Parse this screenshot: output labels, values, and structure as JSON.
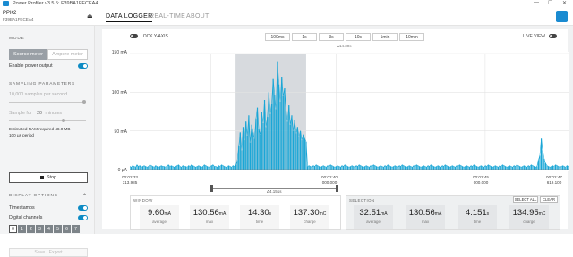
{
  "titlebar": {
    "title": "Power Profiler v3.5.5: F39BA1FECEA4",
    "minimize": "—",
    "maximize": "☐",
    "close": "✕"
  },
  "device": {
    "name": "PPK2",
    "serial": "F39BA1FECEA4"
  },
  "nav": {
    "tabs": [
      {
        "label": "DATA LOGGER"
      },
      {
        "label": "REAL-TIME"
      },
      {
        "label": "ABOUT"
      }
    ]
  },
  "sidebar": {
    "mode_title": "MODE",
    "source_meter": "Source meter",
    "ampere_meter": "Ampere meter",
    "enable_power": "Enable power output",
    "sampling_title": "SAMPLING PARAMETERS",
    "samples_per_second": "10,000 samples per second",
    "sample_for": "Sample for",
    "sample_for_value": "20",
    "sample_for_unit": "minutes",
    "estimated_ram": "Estimated RAM required 48.0 MB",
    "us_period": "100 µs period",
    "stop_label": "Stop",
    "display_title": "DISPLAY OPTIONS",
    "timestamps": "Timestamps",
    "digital_channels": "Digital channels",
    "channels": [
      "0",
      "1",
      "2",
      "3",
      "4",
      "5",
      "6",
      "7"
    ],
    "save_export": "Save / Export"
  },
  "chart_controls": {
    "lock_y_axis": "LOCK Y-AXIS",
    "live_view": "LIVE VIEW",
    "windows": [
      "100ms",
      "1s",
      "3s",
      "10s",
      "1min",
      "10min"
    ],
    "window_duration": "Δ14.30s",
    "selection_duration": "Δ4.151s"
  },
  "chart_data": {
    "type": "line",
    "ylabel": "",
    "y_ticks": [
      "150 mA",
      "100 mA",
      "50 mA",
      "0 µA"
    ],
    "ylim": [
      0,
      150
    ],
    "x_ticks": [
      {
        "time": "00:02:33",
        "ms": "313.985"
      },
      {
        "time": "00:02:40",
        "ms": "000.000"
      },
      {
        "time": "00:02:45",
        "ms": "000.000"
      },
      {
        "time": "00:02:47",
        "ms": "619.100"
      }
    ],
    "selection_range_s": [
      0,
      4.151
    ],
    "series": [
      {
        "values": [
          4,
          3,
          5,
          4,
          3,
          6,
          4,
          5,
          3,
          4,
          5,
          4,
          3,
          4,
          6,
          5,
          4,
          3,
          5,
          4,
          3,
          4,
          5,
          4,
          4,
          3,
          5,
          6,
          4,
          5,
          4,
          3,
          4,
          5,
          6,
          4,
          3,
          5,
          4,
          4,
          3,
          5,
          4,
          6,
          5,
          4,
          3,
          4,
          5,
          4,
          3,
          4,
          6,
          5,
          4,
          3,
          4,
          5,
          6,
          4,
          4,
          3,
          5,
          4,
          6,
          5,
          4,
          3,
          4,
          5,
          4,
          3,
          5,
          4,
          6,
          12,
          30,
          48,
          25,
          55,
          38,
          62,
          44,
          70,
          35,
          58,
          48,
          40,
          66,
          80,
          52,
          45,
          74,
          60,
          90,
          55,
          68,
          100,
          72,
          85,
          118,
          96,
          78,
          140,
          110,
          88,
          120,
          95,
          105,
          76,
          62,
          83,
          58,
          70,
          50,
          64,
          47,
          55,
          42,
          50,
          38,
          45,
          40,
          36,
          4,
          5,
          4,
          3,
          5,
          4,
          6,
          5,
          4,
          3,
          4,
          5,
          4,
          3,
          5,
          4,
          6,
          5,
          4,
          3,
          4,
          5,
          4,
          3,
          5,
          4,
          6,
          5,
          4,
          3,
          4,
          5,
          4,
          3,
          5,
          4,
          6,
          5,
          4,
          3,
          4,
          5,
          4,
          3,
          5,
          4,
          6,
          5,
          4,
          3,
          4,
          5,
          4,
          3,
          5,
          4,
          6,
          5,
          4,
          3,
          4,
          5,
          4,
          3,
          5,
          4,
          6,
          5,
          4,
          3,
          4,
          5,
          4,
          3,
          5,
          4,
          6,
          5,
          4,
          3,
          4,
          5,
          4,
          3,
          5,
          4,
          6,
          5,
          4,
          3,
          4,
          5,
          4,
          3,
          5,
          4,
          6,
          5,
          4,
          3,
          4,
          5,
          4,
          3,
          5,
          4,
          6,
          5,
          4,
          3,
          4,
          5,
          4,
          3,
          5,
          4,
          6,
          5,
          4,
          3,
          4,
          5,
          4,
          3,
          5,
          4,
          6,
          5,
          4,
          3,
          4,
          5,
          4,
          3,
          5,
          4,
          6,
          5,
          4,
          3,
          4,
          5,
          4,
          3,
          5,
          4,
          6,
          5,
          4,
          3,
          4,
          5,
          4,
          3,
          5,
          4,
          6,
          5,
          4,
          3,
          4,
          12,
          18,
          40,
          25,
          14,
          8,
          5,
          4,
          3,
          4,
          5,
          4,
          6,
          5,
          4,
          3,
          4,
          5,
          4,
          3,
          5,
          4
        ]
      }
    ]
  },
  "window_panel": {
    "title": "WINDOW",
    "stats": [
      {
        "value": "9.60",
        "unit": "mA",
        "label": "average"
      },
      {
        "value": "130.56",
        "unit": "mA",
        "label": "max"
      },
      {
        "value": "14.30",
        "unit": "s",
        "label": "time"
      },
      {
        "value": "137.30",
        "unit": "mC",
        "label": "charge"
      }
    ]
  },
  "selection_panel": {
    "title": "SELECTION",
    "select_all": "SELECT ALL",
    "clear": "CLEAR",
    "stats": [
      {
        "value": "32.51",
        "unit": "mA",
        "label": "average"
      },
      {
        "value": "130.56",
        "unit": "mA",
        "label": "max"
      },
      {
        "value": "4.151",
        "unit": "s",
        "label": "time"
      },
      {
        "value": "134.95",
        "unit": "mC",
        "label": "charge"
      }
    ]
  },
  "colors": {
    "accent": "#0d8bc4",
    "series": "#1aa6d6",
    "selection": "#c9ced3"
  }
}
